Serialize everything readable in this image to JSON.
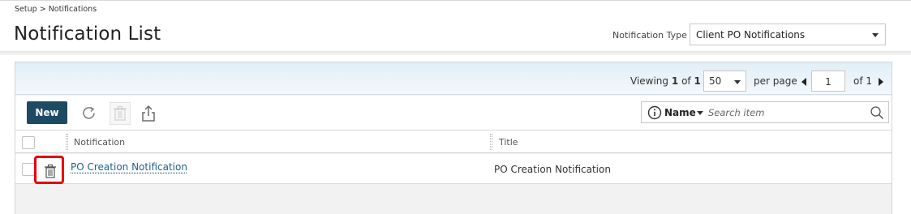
{
  "breadcrumb": {
    "root": "Setup",
    "separator": ">",
    "current": "Notifications"
  },
  "page": {
    "title": "Notification List"
  },
  "notification_type": {
    "label": "Notification Type",
    "selected": "Client PO Notifications"
  },
  "pager": {
    "viewing_label": "Viewing",
    "range_start": "1",
    "of_label": "of",
    "range_total": "1",
    "per_page_value": "50",
    "per_page_label": "per page",
    "current_page": "1",
    "page_total_text": "of 1"
  },
  "toolbar": {
    "new_label": "New",
    "icons": [
      "refresh-icon",
      "trash-icon",
      "export-icon"
    ]
  },
  "search": {
    "field": "Name",
    "placeholder": "Search item",
    "icons": [
      "info-icon",
      "magnifier-icon"
    ]
  },
  "grid": {
    "columns": [
      "Notification",
      "Title"
    ],
    "rows": [
      {
        "notification": "PO Creation Notification",
        "title": "PO Creation Notification"
      }
    ]
  },
  "colors": {
    "primary_button": "#1d4a63",
    "link": "#1f5f8b",
    "highlight": "#e8000b",
    "pager_bar": "#e2eef7"
  }
}
